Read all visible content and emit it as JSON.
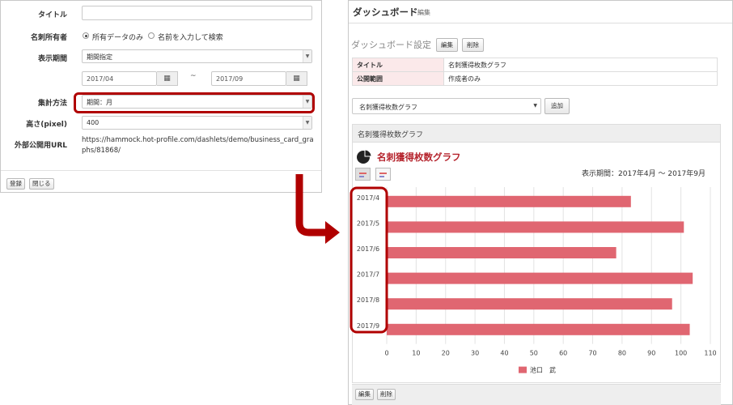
{
  "form": {
    "title_label": "タイトル",
    "title_value": "",
    "owner_label": "名刺所有者",
    "owner_options": [
      "所有データのみ",
      "名前を入力して検索"
    ],
    "period_label": "表示期間",
    "period_value": "期間指定",
    "date_from": "2017/04",
    "date_to": "2017/09",
    "tilde": "~",
    "aggregation_label": "集計方法",
    "aggregation_value": "期間：月",
    "height_label": "高さ(pixel)",
    "height_value": "400",
    "url_label": "外部公開用URL",
    "url_value": "https://hammock.hot-profile.com/dashlets/demo/business_card_graphs/81868/",
    "register_button": "登録",
    "close_button": "閉じる"
  },
  "dashboard": {
    "title": "ダッシュボード",
    "edit_link": "編集",
    "settings_title": "ダッシュボード設定",
    "settings_edit_button": "編集",
    "settings_delete_button": "削除",
    "table": [
      {
        "key": "タイトル",
        "value": "名刺獲得枚数グラフ"
      },
      {
        "key": "公開範囲",
        "value": "作成者のみ"
      }
    ],
    "select_value": "名刺獲得枚数グラフ",
    "add_button": "追加",
    "widget_header": "名刺獲得枚数グラフ",
    "chart_title": "名刺獲得枚数グラフ",
    "period_text": "表示期間：2017年4月 〜 2017年9月",
    "footer_edit": "編集",
    "footer_delete": "削除"
  },
  "colors": {
    "bar": "#e06671",
    "highlight": "#b00000",
    "chart_title": "#b5232c"
  },
  "chart_data": {
    "type": "bar",
    "orientation": "horizontal",
    "categories": [
      "2017/4",
      "2017/5",
      "2017/6",
      "2017/7",
      "2017/8",
      "2017/9"
    ],
    "series": [
      {
        "name": "池口　武",
        "values": [
          83,
          101,
          78,
          104,
          97,
          103
        ]
      }
    ],
    "xlim": [
      0,
      110
    ],
    "xticks": [
      0,
      10,
      20,
      30,
      40,
      50,
      60,
      70,
      80,
      90,
      100,
      110
    ],
    "grid": true,
    "legend": "bottom"
  }
}
